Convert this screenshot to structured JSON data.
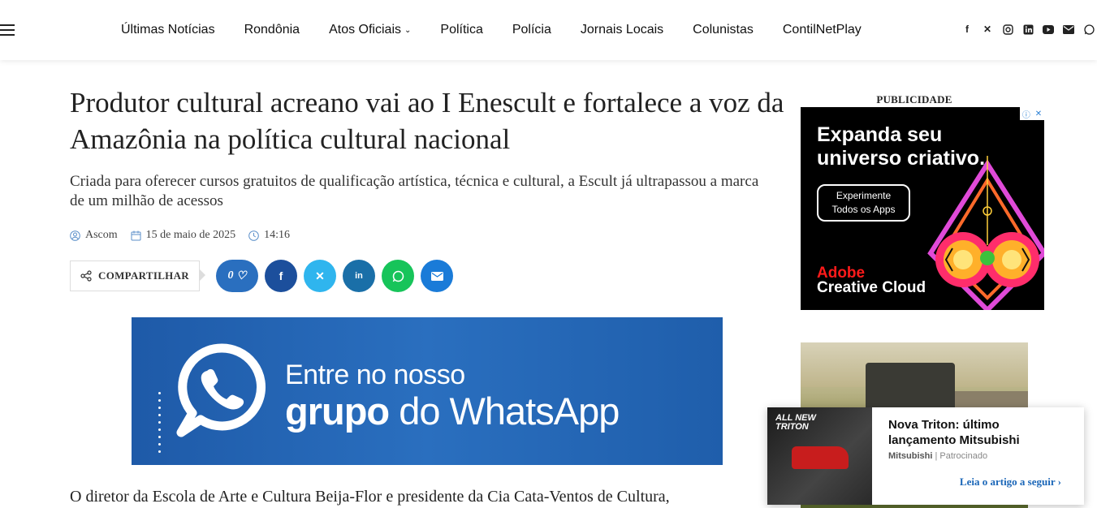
{
  "nav": {
    "items": [
      "Últimas Notícias",
      "Rondônia",
      "Atos Oficiais",
      "Política",
      "Polícia",
      "Jornais Locais",
      "Colunistas",
      "ContilNetPlay"
    ],
    "dropdown_chevron": "⌄"
  },
  "socials": [
    "facebook-icon",
    "x-icon",
    "instagram-icon",
    "linkedin-icon",
    "youtube-icon",
    "email-icon",
    "whatsapp-icon"
  ],
  "article": {
    "title": "Produtor cultural acreano vai ao I Enescult e fortalece a voz da Amazônia na política cultural nacional",
    "subtitle": "Criada para oferecer cursos gratuitos de qualificação artística, técnica e cultural, a Escult já ultrapassou a marca de um milhão de acessos",
    "author": "Ascom",
    "date": "15 de maio de 2025",
    "time": "14:16",
    "share_label": "COMPARTILHAR",
    "likes": "0",
    "body_first_line": "O diretor da Escola de Arte e Cultura Beija-Flor e presidente da Cia Cata-Ventos de Cultura,"
  },
  "whatsapp_banner": {
    "line1": "Entre no nosso",
    "line2_bold": "grupo",
    "line2_rest": " do WhatsApp"
  },
  "sidebar": {
    "ad_label": "PUBLICIDADE",
    "adobe": {
      "headline_1": "Expanda seu",
      "headline_2": "universo criativo.",
      "button_1": "Experimente",
      "button_2": "Todos os Apps",
      "brand_1": "Adobe",
      "brand_2": "Creative Cloud"
    }
  },
  "popup": {
    "title": "Nova Triton: último lançamento Mitsubishi",
    "source": "Mitsubishi",
    "sponsored": "| Patrocinado",
    "link": "Leia o artigo a seguir",
    "thumb_text_1": "ALL NEW",
    "thumb_text_2": "TRITON"
  },
  "colors": {
    "facebook": "#1c4f9c",
    "x": "#2fb5ee",
    "linkedin": "#1a6fa8",
    "whatsapp": "#17c45a",
    "email": "#1a7bd8",
    "likes": "#2a6fbf"
  }
}
